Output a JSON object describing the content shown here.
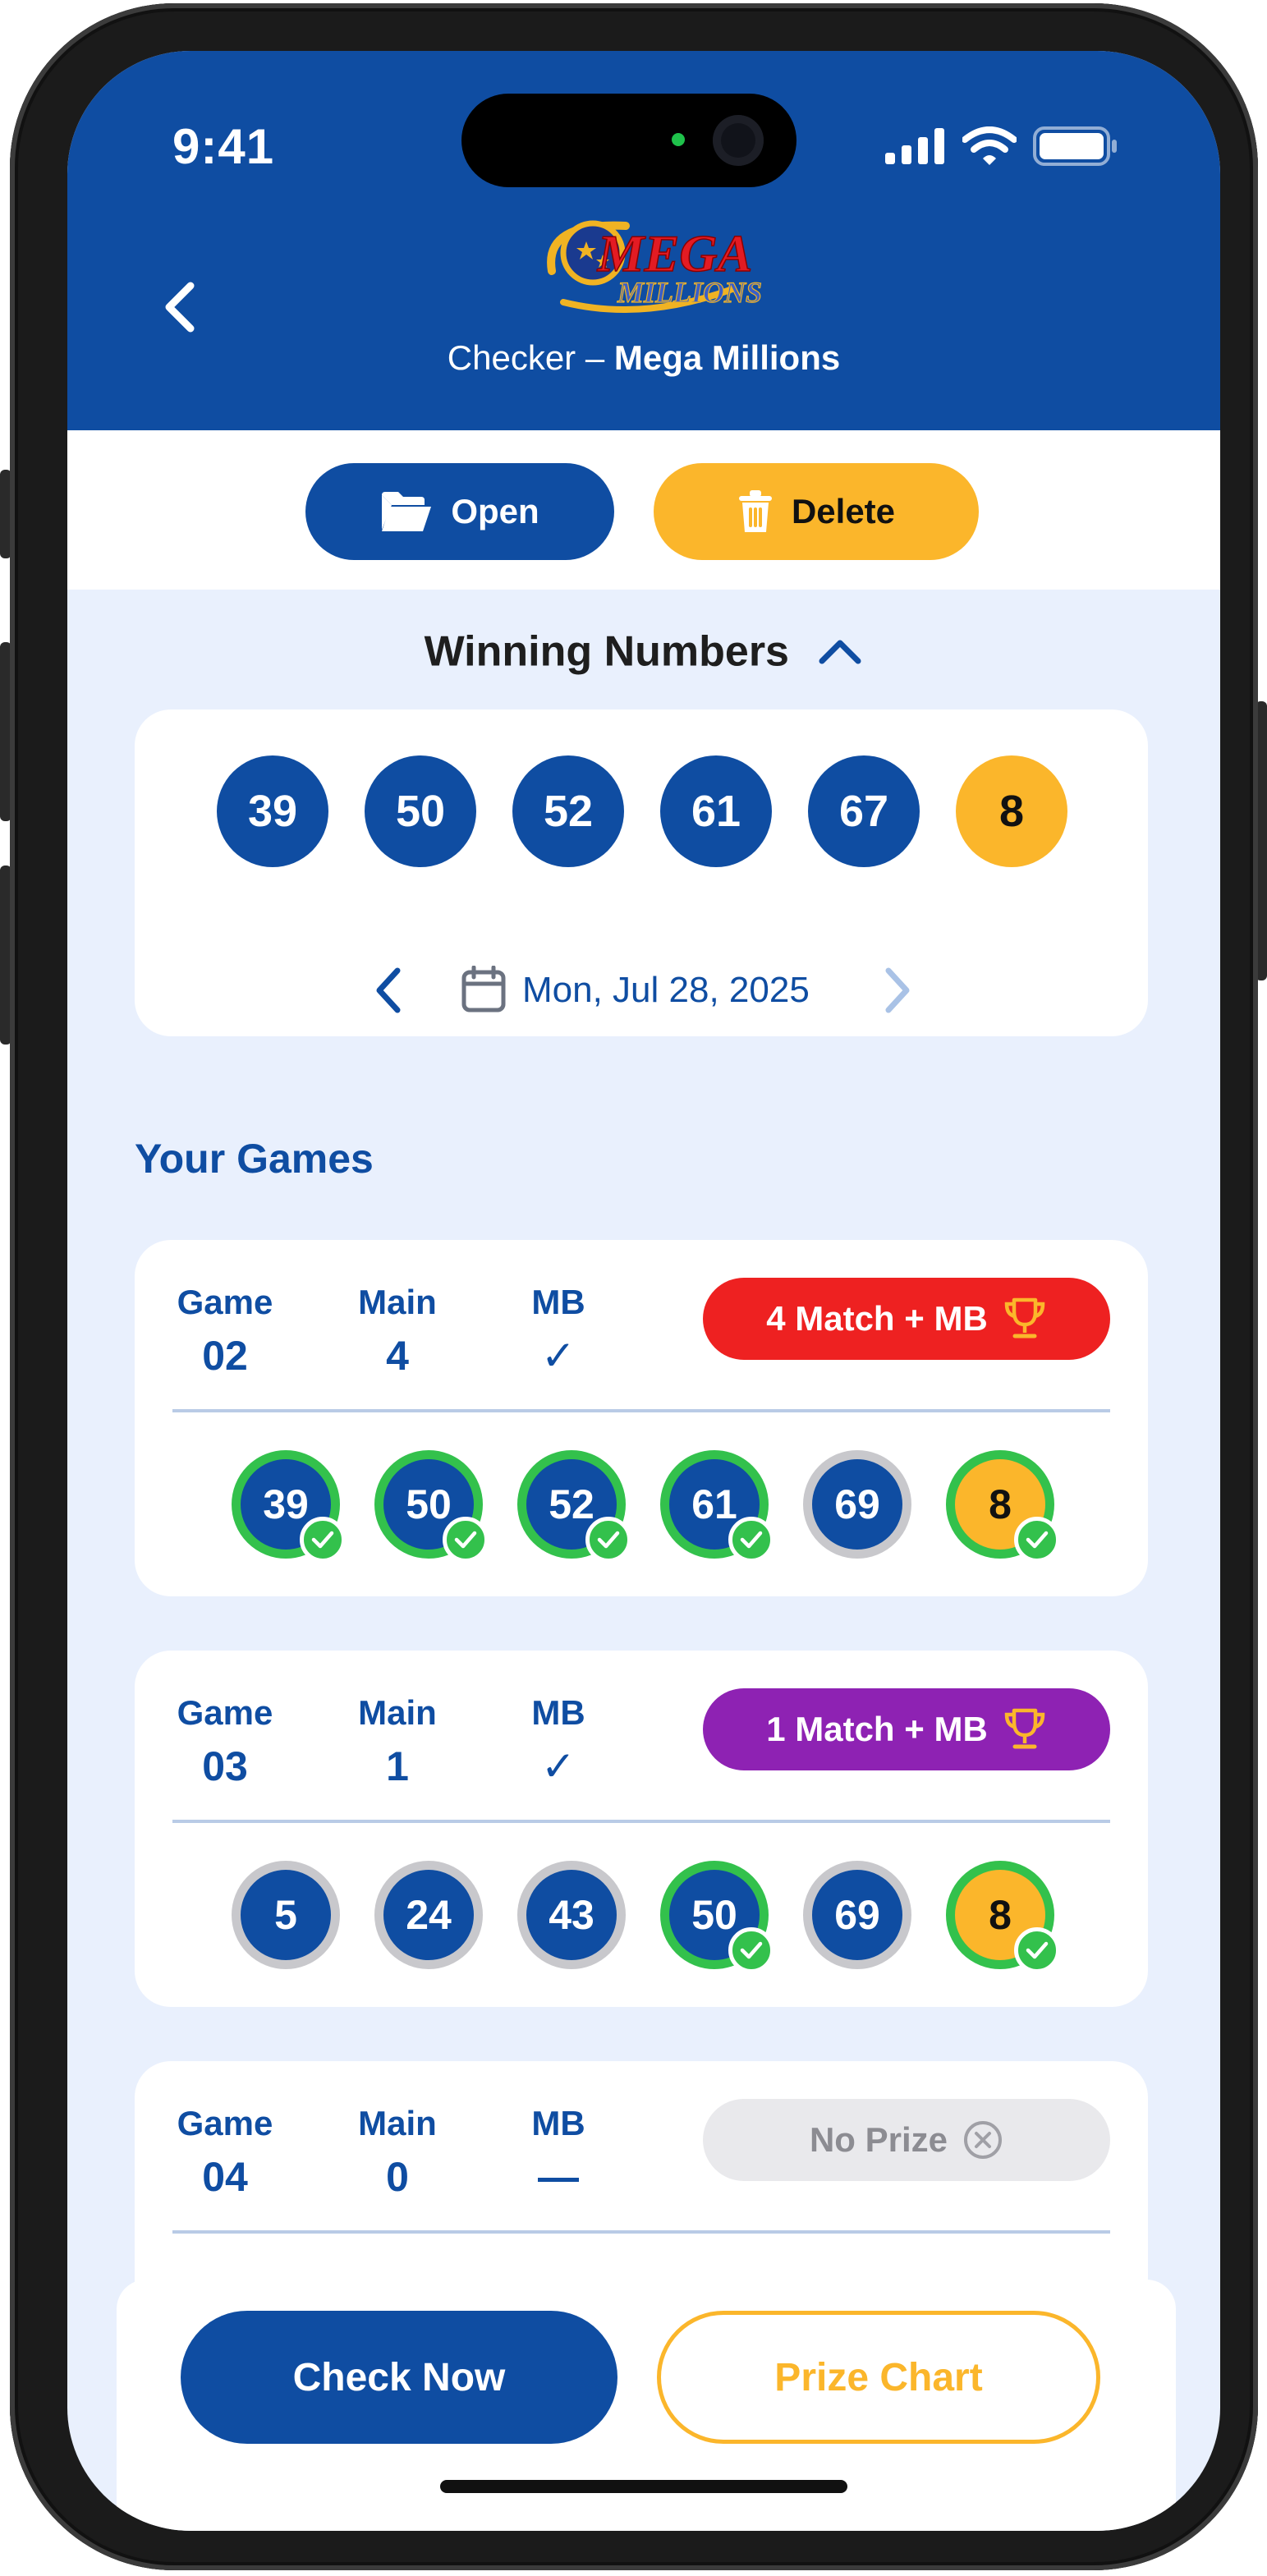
{
  "status_bar": {
    "time": "9:41"
  },
  "header": {
    "logo_text_top": "MEGA",
    "logo_text_bottom": "MILLIONS",
    "subtitle_prefix": "Checker – ",
    "subtitle_game": "Mega Millions"
  },
  "actions": {
    "open_label": "Open",
    "delete_label": "Delete"
  },
  "winning": {
    "title": "Winning Numbers",
    "main_numbers": [
      "39",
      "50",
      "52",
      "61",
      "67"
    ],
    "mega_ball": "8",
    "date": "Mon, Jul 28, 2025"
  },
  "games_title": "Your Games",
  "games": [
    {
      "col_game": "Game",
      "col_main": "Main",
      "col_mb": "MB",
      "game_no": "02",
      "main_matches": "4",
      "mb_match": "✓",
      "result": "4 Match + MB",
      "result_color": "#ee2121",
      "balls": [
        "39",
        "50",
        "52",
        "61",
        "69",
        "8"
      ],
      "hits": [
        true,
        true,
        true,
        true,
        false,
        true
      ]
    },
    {
      "col_game": "Game",
      "col_main": "Main",
      "col_mb": "MB",
      "game_no": "03",
      "main_matches": "1",
      "mb_match": "✓",
      "result": "1 Match + MB",
      "result_color": "#8e22b3",
      "balls": [
        "5",
        "24",
        "43",
        "50",
        "69",
        "8"
      ],
      "hits": [
        false,
        false,
        false,
        true,
        false,
        true
      ]
    },
    {
      "col_game": "Game",
      "col_main": "Main",
      "col_mb": "MB",
      "game_no": "04",
      "main_matches": "0",
      "mb_match": "—",
      "result": "No Prize",
      "result_color": "#e9e9ec"
    }
  ],
  "bottom": {
    "check_label": "Check Now",
    "prize_label": "Prize Chart"
  },
  "colors": {
    "primary": "#0f4da2",
    "gold": "#fbb62b",
    "match_green": "#33c14c",
    "background": "#e9f0fd"
  }
}
